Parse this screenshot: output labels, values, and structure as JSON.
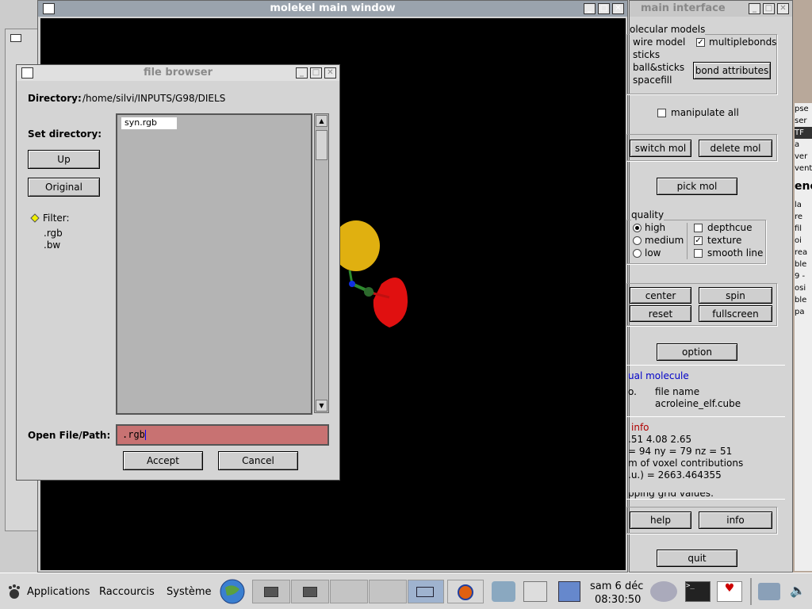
{
  "main_window": {
    "title": "molekel main window"
  },
  "main_interface": {
    "title": "main interface",
    "molecular_models_legend": "olecular models",
    "models": [
      "wire model",
      "sticks",
      "ball&sticks",
      "spacefill"
    ],
    "multiplebonds_label": "multiplebonds",
    "bond_attributes_label": "bond attributes",
    "manipulate_all_label": "manipulate all",
    "switch_mol_label": "switch mol",
    "delete_mol_label": "delete mol",
    "pick_mol_label": "pick mol",
    "quality_legend": "quality",
    "quality_options": [
      "high",
      "medium",
      "low"
    ],
    "depthcue_label": "depthcue",
    "texture_label": "texture",
    "smooth_line_label": "smooth line",
    "center_label": "center",
    "spin_label": "spin",
    "reset_label": "reset",
    "fullscreen_label": "fullscreen",
    "option_label": "option",
    "actual_molecule_heading": "ual molecule",
    "col_no": "o.",
    "col_file_name": "file name",
    "file_name_value": "acroleine_elf.cube",
    "info_heading": "info",
    "info_line1": ".51     4.08     2.65",
    "info_line2": "= 94   ny = 79   nz = 51",
    "info_line3": "m of voxel contributions",
    "info_line4": ".u.) = 2663.464355",
    "info_line5": "pping grid values:",
    "help_label": "help",
    "info_label": "info",
    "quit_label": "quit"
  },
  "file_browser": {
    "title": "file browser",
    "directory_label": "Directory:",
    "directory_value": "/home/silvi/INPUTS/G98/DIELS",
    "set_directory_label": "Set directory:",
    "up_label": "Up",
    "original_label": "Original",
    "filter_label": "Filter:",
    "filters": [
      ".rgb",
      ".bw"
    ],
    "files": [
      "syn.rgb"
    ],
    "open_label": "Open File/Path:",
    "open_value": ".rgb",
    "accept_label": "Accept",
    "cancel_label": "Cancel"
  },
  "taskbar": {
    "applications": "Applications",
    "shortcuts": "Raccourcis",
    "system": "Système",
    "date": "sam  6 déc",
    "time": "08:30:50"
  },
  "background_fragments": [
    "pse",
    "ser",
    "TF",
    "a",
    "ver",
    "vent",
    "ene",
    "la",
    "re",
    "fil",
    "oi",
    "rea",
    "ble",
    "9 -",
    "osi",
    "ble",
    "pa"
  ]
}
